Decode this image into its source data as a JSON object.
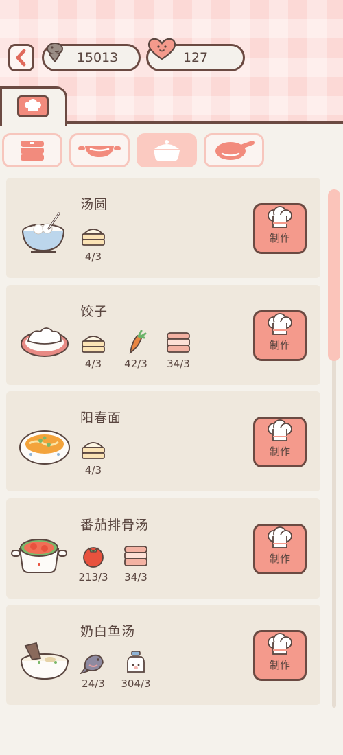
{
  "currency": {
    "fish": {
      "icon": "fish-icon",
      "value": "15013"
    },
    "heart": {
      "icon": "heart-face-icon",
      "value": "127"
    }
  },
  "tabs": [
    {
      "icon": "chef-hat-icon",
      "active": true
    }
  ],
  "categories": [
    {
      "icon": "steamer-icon",
      "active": false
    },
    {
      "icon": "wok-icon",
      "active": false
    },
    {
      "icon": "pot-icon",
      "active": true
    },
    {
      "icon": "frying-pan-icon",
      "active": false
    }
  ],
  "recipes": [
    {
      "name": "汤圆",
      "image": "tangyuan-bowl-icon",
      "ingredients": [
        {
          "icon": "steamed-bun-icon",
          "count": "4/3"
        }
      ],
      "button": "制作"
    },
    {
      "name": "饺子",
      "image": "dumpling-plate-icon",
      "ingredients": [
        {
          "icon": "steamed-bun-icon",
          "count": "4/3"
        },
        {
          "icon": "carrot-icon",
          "count": "42/3"
        },
        {
          "icon": "meat-icon",
          "count": "34/3"
        }
      ],
      "button": "制作"
    },
    {
      "name": "阳春面",
      "image": "noodle-bowl-icon",
      "ingredients": [
        {
          "icon": "steamed-bun-icon",
          "count": "4/3"
        }
      ],
      "button": "制作"
    },
    {
      "name": "番茄排骨汤",
      "image": "tomato-soup-pot-icon",
      "ingredients": [
        {
          "icon": "tomato-icon",
          "count": "213/3"
        },
        {
          "icon": "meat-icon",
          "count": "34/3"
        }
      ],
      "button": "制作"
    },
    {
      "name": "奶白鱼汤",
      "image": "fish-soup-bowl-icon",
      "ingredients": [
        {
          "icon": "fish-icon",
          "count": "24/3"
        },
        {
          "icon": "milk-bottle-icon",
          "count": "304/3"
        }
      ],
      "button": "制作"
    }
  ],
  "colors": {
    "accent": "#f49a8c",
    "outline": "#6b4a42",
    "card": "#efe8dd",
    "background": "#f5f2ec"
  }
}
